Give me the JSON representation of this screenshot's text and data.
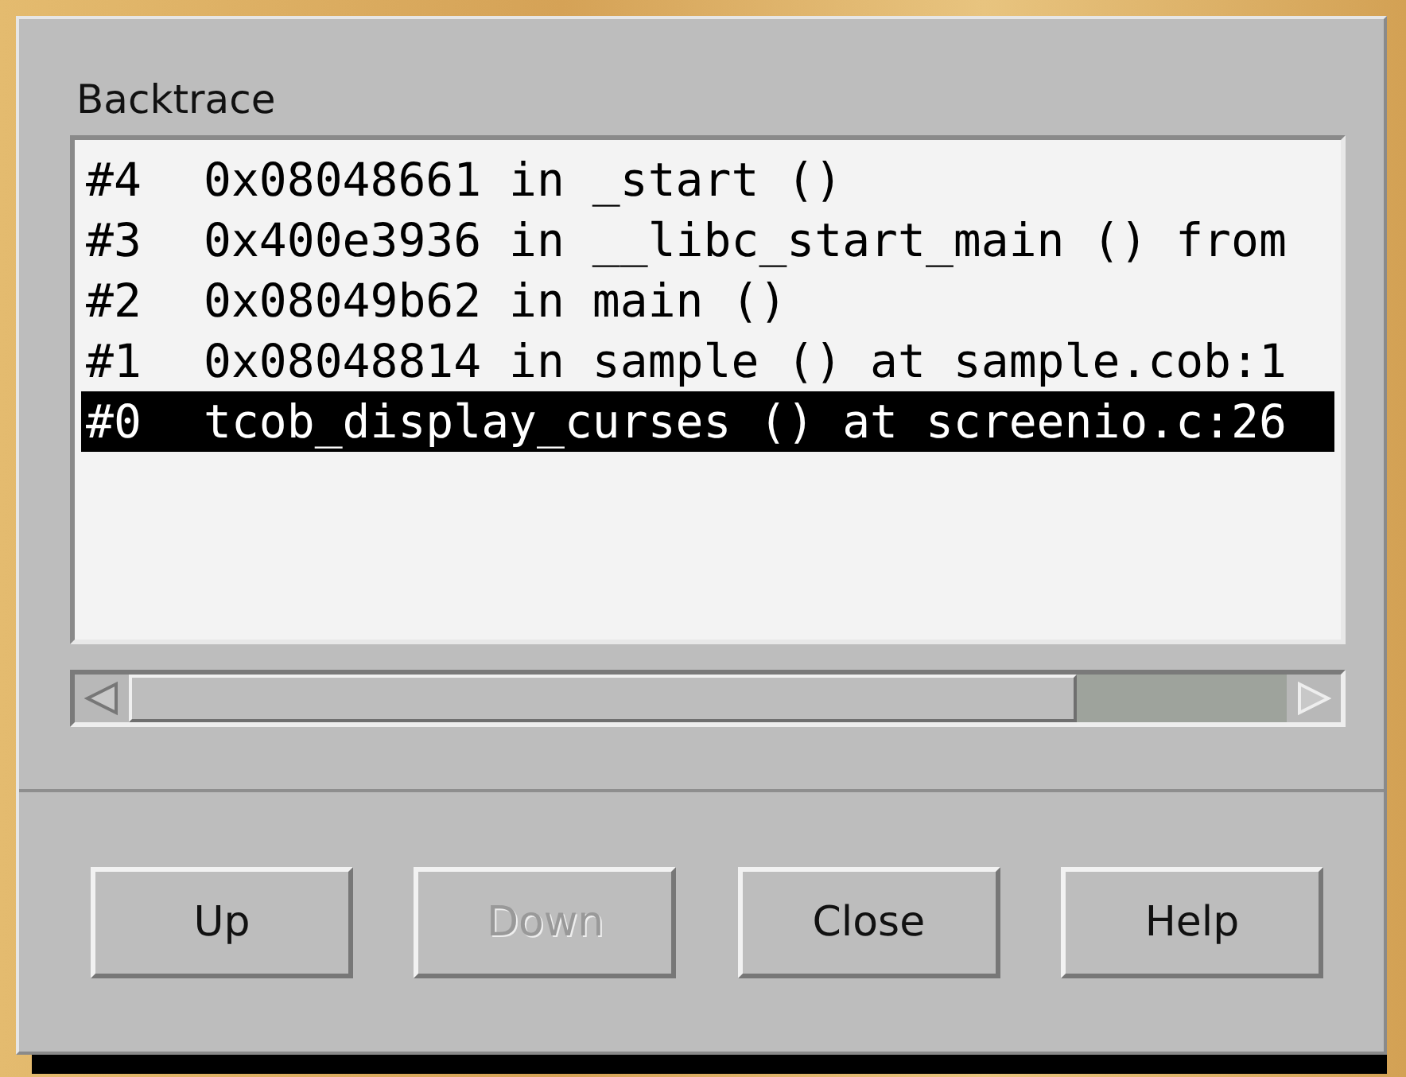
{
  "dialog": {
    "label": "Backtrace"
  },
  "frames": [
    {
      "number": "#4",
      "text": "0x08048661 in _start ()",
      "selected": false
    },
    {
      "number": "#3",
      "text": "0x400e3936 in __libc_start_main () from",
      "selected": false
    },
    {
      "number": "#2",
      "text": "0x08049b62 in main ()",
      "selected": false
    },
    {
      "number": "#1",
      "text": "0x08048814 in sample () at sample.cob:1",
      "selected": false
    },
    {
      "number": "#0",
      "text": "tcob_display_curses () at screenio.c:26",
      "selected": true
    }
  ],
  "buttons": [
    {
      "label": "Up",
      "disabled": false
    },
    {
      "label": "Down",
      "disabled": true
    },
    {
      "label": "Close",
      "disabled": false
    },
    {
      "label": "Help",
      "disabled": false
    }
  ]
}
